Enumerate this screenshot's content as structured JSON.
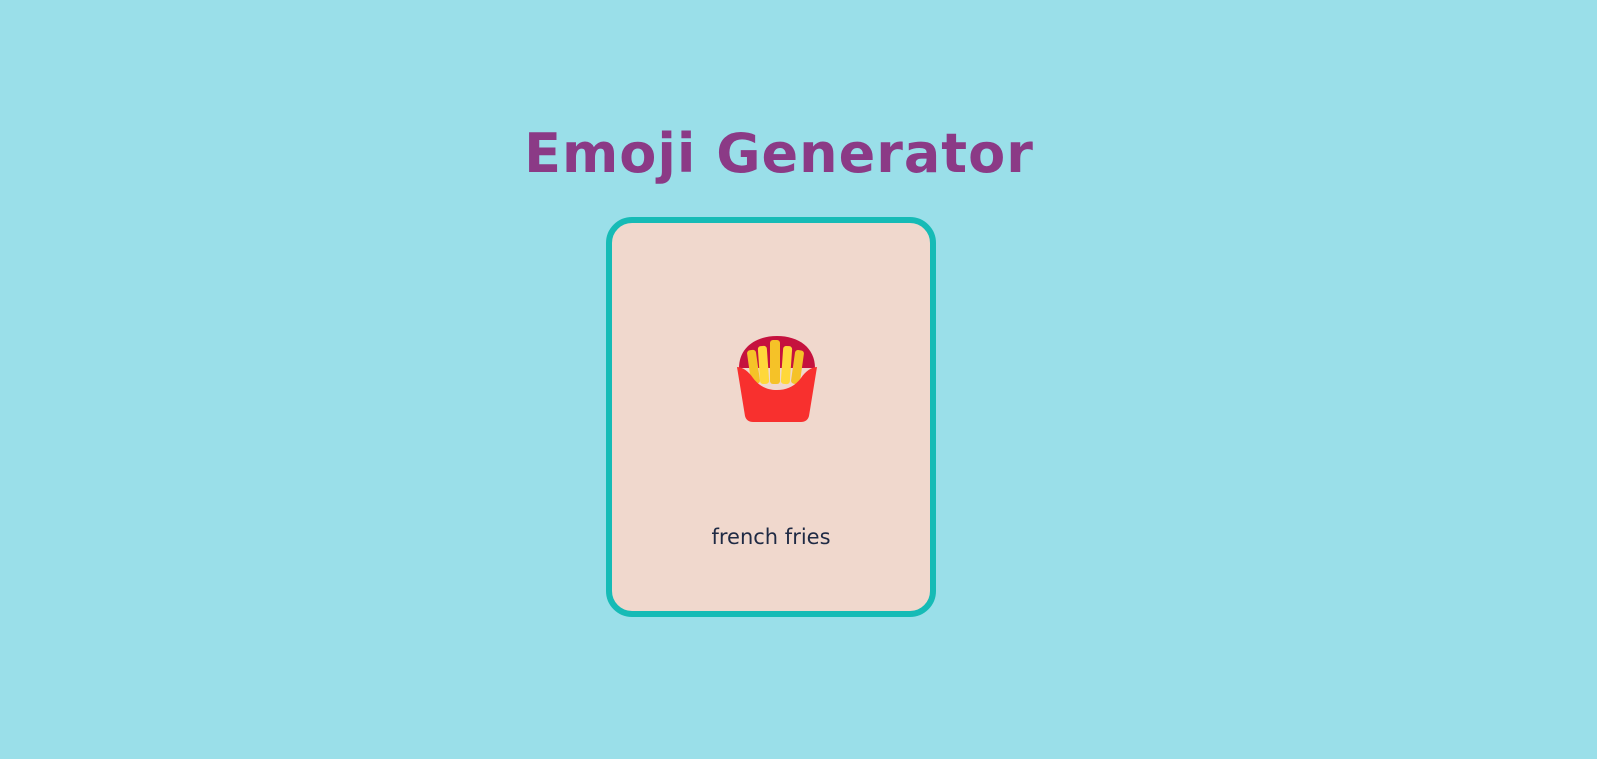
{
  "page": {
    "title": "Emoji Generator",
    "background_color": "#9adfe9",
    "title_color": "#8b3a86"
  },
  "card": {
    "emoji_icon": "french-fries-icon",
    "emoji_name": "french fries",
    "border_color": "#16bbb6",
    "background_color": "#f0d8cd"
  }
}
